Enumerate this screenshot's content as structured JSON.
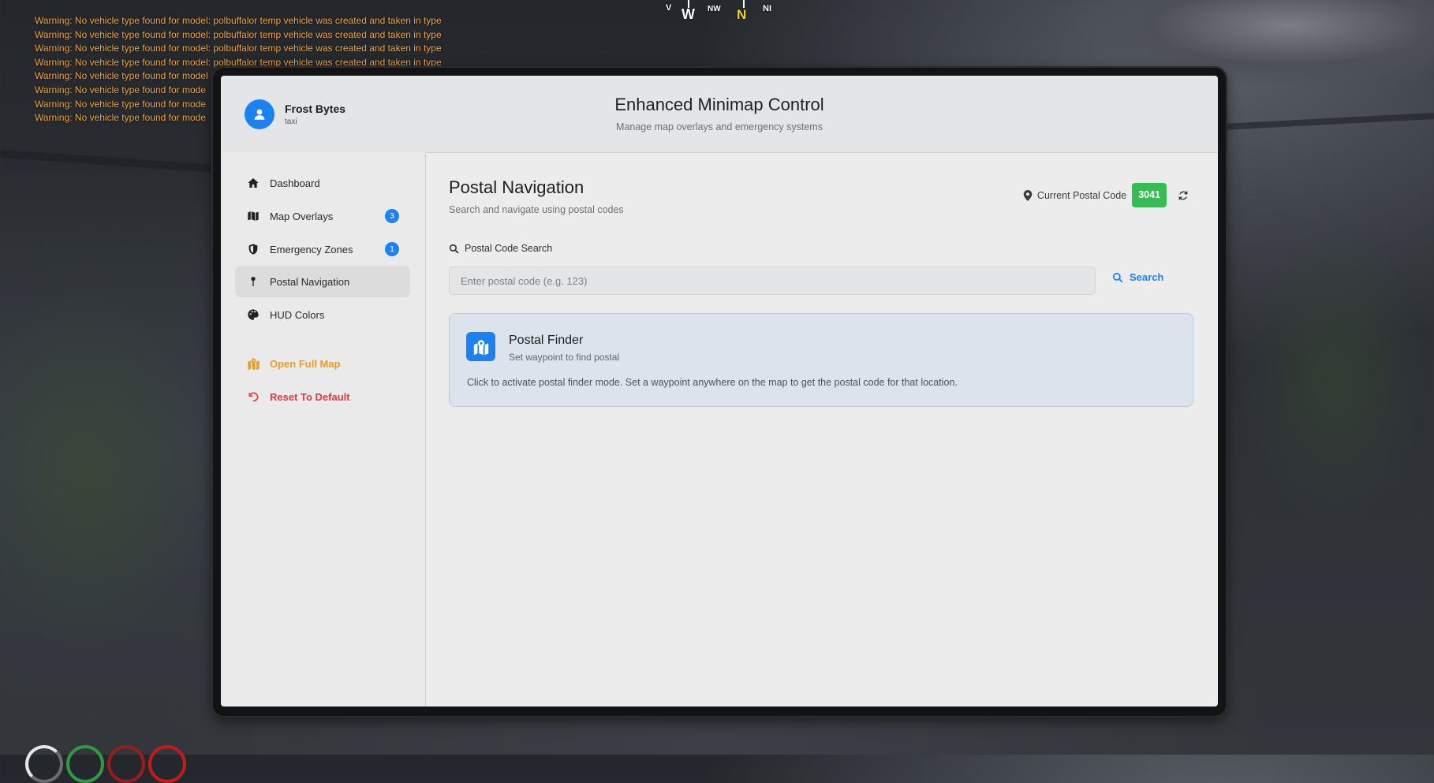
{
  "console": {
    "lines": [
      "Warning: No vehicle type found for model: polbuffalor temp vehicle was created and taken in type",
      "Warning: No vehicle type found for model: polbuffalor temp vehicle was created and taken in type",
      "Warning: No vehicle type found for model: polbuffalor temp vehicle was created and taken in type",
      "Warning: No vehicle type found for model: polbuffalor temp vehicle was created and taken in type",
      "Warning: No vehicle type found for model",
      "Warning: No vehicle type found for mode",
      "Warning: No vehicle type found for mode",
      "Warning: No vehicle type found for mode"
    ]
  },
  "compass": {
    "w": "W",
    "nw": "NW",
    "n": "N",
    "ne": "NI",
    "left": "V"
  },
  "header": {
    "user_name": "Frost Bytes",
    "user_job": "taxi",
    "title": "Enhanced Minimap Control",
    "subtitle": "Manage map overlays and emergency systems"
  },
  "sidebar": {
    "items": [
      {
        "label": "Dashboard",
        "icon": "home-icon"
      },
      {
        "label": "Map Overlays",
        "icon": "map-icon",
        "badge": "3"
      },
      {
        "label": "Emergency Zones",
        "icon": "shield-icon",
        "badge": "1"
      },
      {
        "label": "Postal Navigation",
        "icon": "pin-icon",
        "active": true
      },
      {
        "label": "HUD Colors",
        "icon": "palette-icon"
      }
    ],
    "actions": [
      {
        "label": "Open Full Map",
        "icon": "map-location-icon",
        "color": "#f29a1b"
      },
      {
        "label": "Reset To Default",
        "icon": "undo-icon",
        "color": "#e5393a"
      }
    ]
  },
  "main": {
    "title": "Postal Navigation",
    "subtitle": "Search and navigate using postal codes",
    "current_postal_label": "Current Postal Code",
    "current_postal_code": "3041",
    "search_label": "Postal Code Search",
    "search_placeholder": "Enter postal code (e.g. 123)",
    "search_value": "",
    "search_button": "Search",
    "finder": {
      "title": "Postal Finder",
      "subtitle": "Set waypoint to find postal",
      "description": "Click to activate postal finder mode. Set a waypoint anywhere on the map to get the postal code for that location."
    }
  },
  "colors": {
    "accent": "#1a82f2",
    "postal_badge": "#33bd54",
    "warning_text": "#f2a640",
    "open_map": "#f29a1b",
    "reset": "#e5393a"
  }
}
